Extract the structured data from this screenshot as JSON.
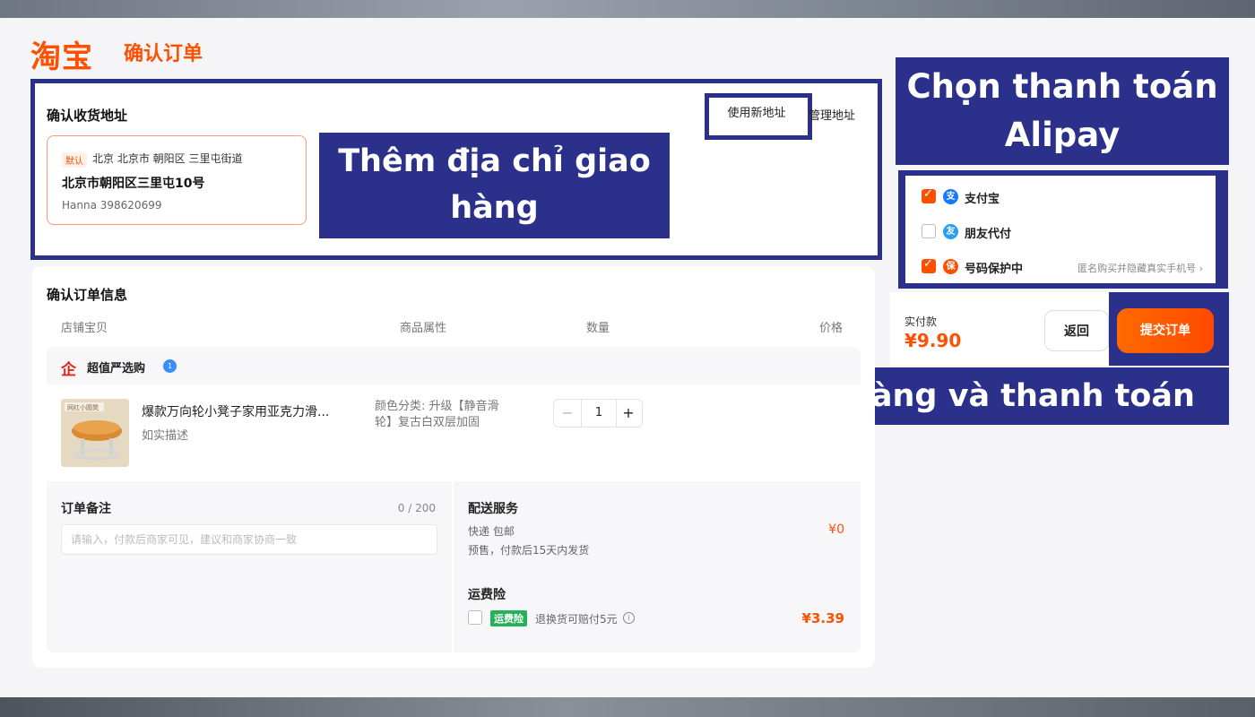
{
  "brand": {
    "logo_text": "淘宝",
    "page_title": "确认订单"
  },
  "address": {
    "section_title": "确认收货地址",
    "new_address_label": "使用新地址",
    "manage_address_label": "管理地址",
    "default_tag": "默认",
    "region": "北京 北京市 朝阳区 三里屯街道",
    "detail": "北京市朝阳区三里屯10号",
    "contact": "Hanna   398620699"
  },
  "callouts": {
    "address_line1": "Thêm địa chỉ giao",
    "address_line2": "hàng",
    "payment_line1": "Chọn thanh toán",
    "payment_line2": "Alipay",
    "order": "Đặt hàng và thanh toán"
  },
  "payment": {
    "options": [
      {
        "label": "支付宝",
        "checked": true,
        "icon": "alipay-icon",
        "color": "#1677ff",
        "glyph": "支"
      },
      {
        "label": "朋友代付",
        "checked": false,
        "icon": "friend-pay-icon",
        "color": "#2a9df4",
        "glyph": "友"
      },
      {
        "label": "号码保护中",
        "checked": true,
        "icon": "shield-icon",
        "color": "#ff5000",
        "glyph": "保",
        "hint": "匿名购买并隐藏真实手机号 ›"
      }
    ],
    "total_label": "实付款",
    "total_value": "¥9.90",
    "back_label": "返回",
    "submit_label": "提交订单"
  },
  "order": {
    "section_title": "确认订单信息",
    "columns": [
      "店铺宝贝",
      "商品属性",
      "数量",
      "价格"
    ],
    "shop_name": "超值严选购",
    "shop_badge": "1",
    "item": {
      "title": "爆款万向轮小凳子家用亚克力滑...",
      "subtitle": "如实描述",
      "attribute": "颜色分类: 升级【静音滑轮】复古白双层加固",
      "quantity": "1",
      "thumb_caption": "网红小圆凳"
    },
    "note": {
      "title": "订单备注",
      "count": "0 / 200",
      "placeholder": "请输入，付款后商家可见，建议和商家协商一致"
    },
    "shipping": {
      "title": "配送服务",
      "method": "快递 包邮",
      "note": "预售，付款后15天内发货",
      "price": "¥0",
      "insurance_title": "运费险",
      "insurance_tag": "运费险",
      "insurance_desc": "退换货可赔付5元",
      "insurance_price": "¥3.39"
    }
  },
  "colors": {
    "brand": "#ff5000",
    "annotation": "#2b318a"
  }
}
